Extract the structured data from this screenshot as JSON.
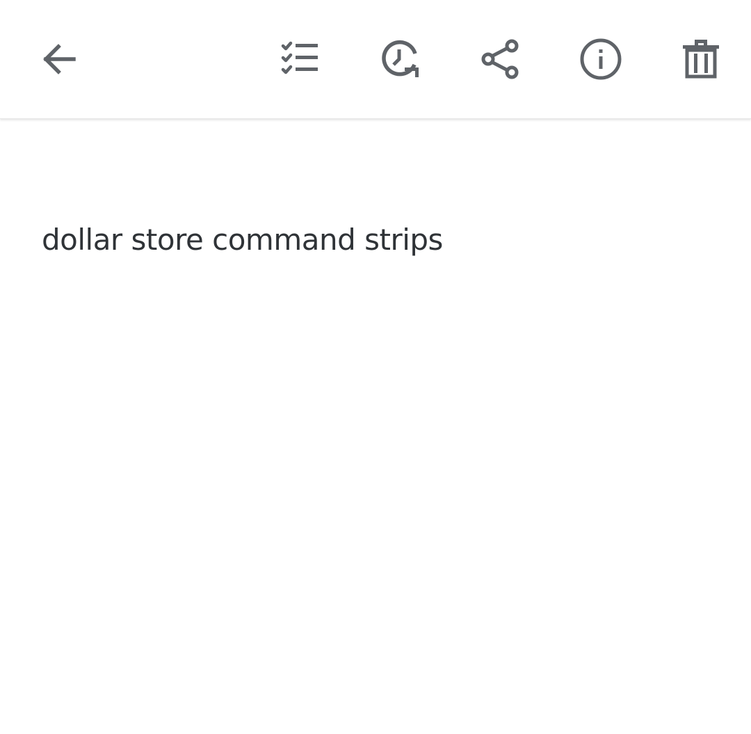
{
  "toolbar": {
    "icons": {
      "back": "arrow-back-icon",
      "checklist": "checklist-icon",
      "reminder": "reminder-clock-icon",
      "share": "share-icon",
      "info": "info-icon",
      "delete": "trash-icon"
    },
    "icon_color": "#5f6368"
  },
  "note": {
    "text": "dollar store command strips"
  }
}
